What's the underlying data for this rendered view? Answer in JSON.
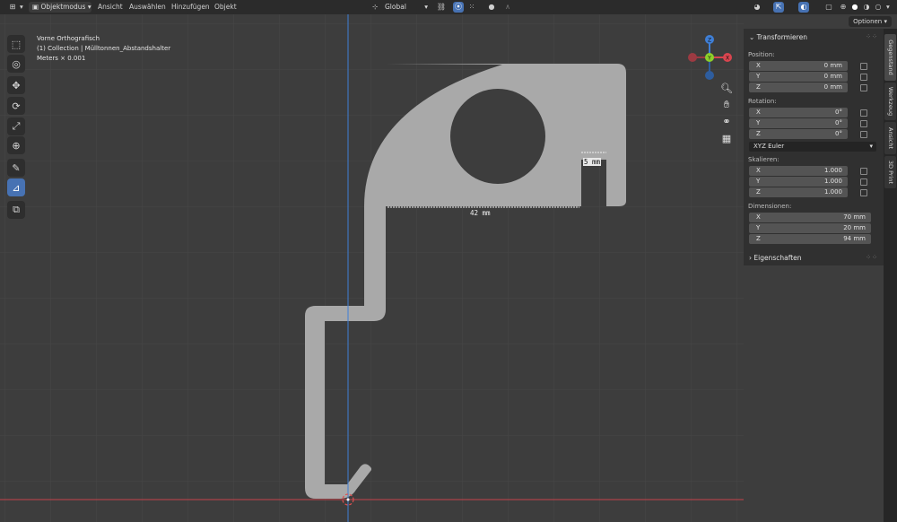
{
  "header": {
    "editor_icon": "viewport-editor-icon",
    "mode_label": "Objektmodus",
    "menus": [
      "Ansicht",
      "Auswählen",
      "Hinzufügen",
      "Objekt"
    ],
    "transform_orientation": "Global",
    "options_label": "Optionen"
  },
  "viewport": {
    "view_name": "Vorne Orthografisch",
    "collection_line": "(1) Collection | Mülltonnen_Abstandshalter",
    "units_line": "Meters × 0.001",
    "measure_width": "42 mm",
    "measure_gap": "5 mm",
    "gizmo": {
      "z": "Z",
      "y": "Y",
      "x": "X"
    }
  },
  "tools": [
    {
      "name": "select-box-tool",
      "icon": "select-icon"
    },
    {
      "name": "cursor-tool",
      "icon": "cursor-icon"
    },
    {
      "name": "move-tool",
      "icon": "move-icon"
    },
    {
      "name": "rotate-tool",
      "icon": "rotate-icon"
    },
    {
      "name": "scale-tool",
      "icon": "scale-icon"
    },
    {
      "name": "transform-tool",
      "icon": "transform-icon"
    },
    {
      "name": "annotate-tool",
      "icon": "annotate-icon"
    },
    {
      "name": "measure-tool",
      "icon": "measure-icon"
    },
    {
      "name": "add-cube-tool",
      "icon": "add-cube-icon"
    }
  ],
  "panel": {
    "title": "Transformieren",
    "position_label": "Position:",
    "position": {
      "x": "0 mm",
      "y": "0 mm",
      "z": "0 mm"
    },
    "rotation_label": "Rotation:",
    "rotation": {
      "x": "0°",
      "y": "0°",
      "z": "0°"
    },
    "rotation_mode": "XYZ Euler",
    "scale_label": "Skalieren:",
    "scale": {
      "x": "1.000",
      "y": "1.000",
      "z": "1.000"
    },
    "dimensions_label": "Dimensionen:",
    "dimensions": {
      "x": "70 mm",
      "y": "20 mm",
      "z": "94 mm"
    },
    "properties_title": "Eigenschaften",
    "axis_labels": {
      "x": "X",
      "y": "Y",
      "z": "Z"
    }
  },
  "tabs": [
    "Gegenstand",
    "Werkzeug",
    "Ansicht",
    "3D Print"
  ],
  "colors": {
    "viewport_bg": "#3d3d3d",
    "grid": "#464646",
    "object": "#a9a9a9",
    "x_axis": "#d9454f",
    "y_axis": "#8ccf2a",
    "z_axis": "#3f7fd6",
    "active_tool": "#4772b3"
  }
}
